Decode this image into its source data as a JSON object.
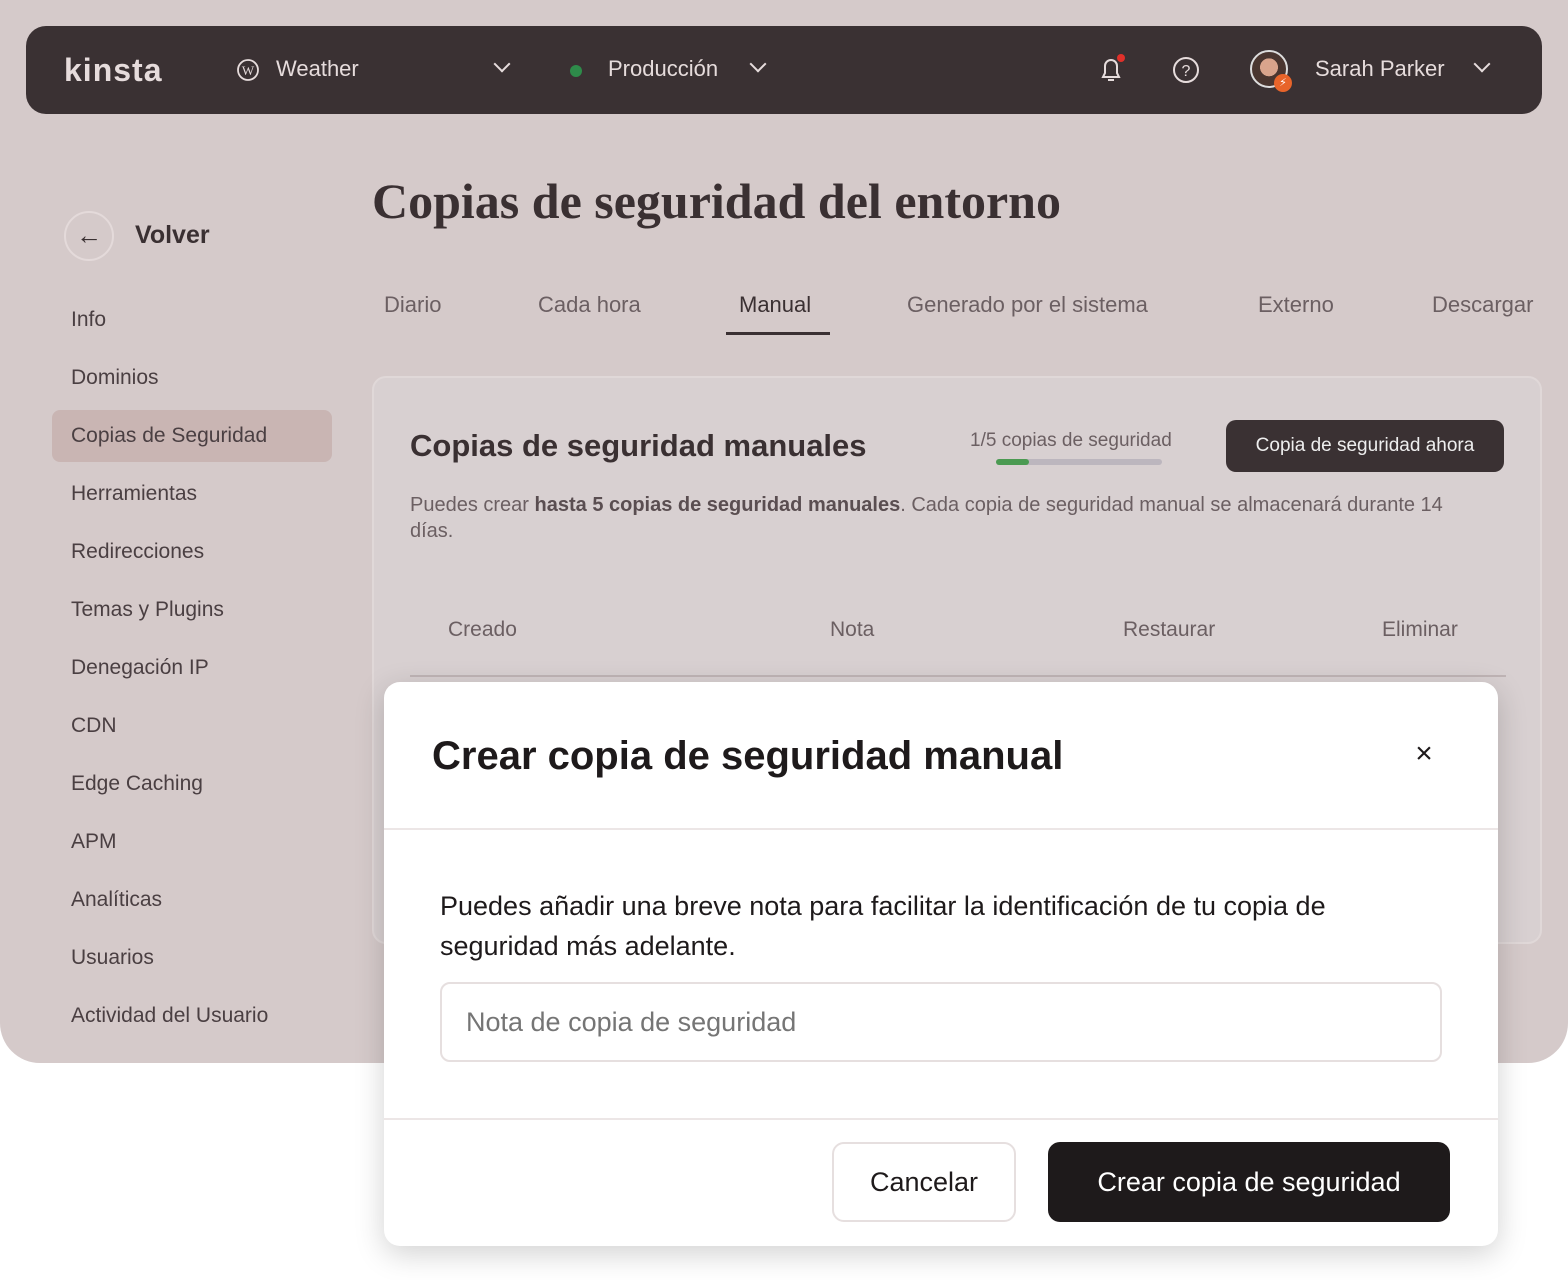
{
  "topbar": {
    "logo": "kinsta",
    "site": "Weather",
    "environment": "Producción",
    "env_color": "#2e8b4a",
    "user": "Sarah Parker"
  },
  "sidebar": {
    "back": "Volver",
    "items": [
      {
        "label": "Info"
      },
      {
        "label": "Dominios"
      },
      {
        "label": "Copias de Seguridad",
        "active": true
      },
      {
        "label": "Herramientas"
      },
      {
        "label": "Redirecciones"
      },
      {
        "label": "Temas y Plugins"
      },
      {
        "label": "Denegación IP"
      },
      {
        "label": "CDN"
      },
      {
        "label": "Edge Caching"
      },
      {
        "label": "APM"
      },
      {
        "label": "Analíticas"
      },
      {
        "label": "Usuarios"
      },
      {
        "label": "Actividad del Usuario"
      }
    ]
  },
  "main": {
    "title": "Copias de seguridad del entorno",
    "tabs": [
      "Diario",
      "Cada hora",
      "Manual",
      "Generado por el sistema",
      "Externo",
      "Descargar"
    ],
    "card": {
      "title": "Copias de seguridad manuales",
      "usage": "1/5 copias de seguridad",
      "usage_fraction": 0.2,
      "button": "Copia de seguridad ahora",
      "desc_pre": "Puedes crear ",
      "desc_bold": "hasta 5 copias de seguridad manuales",
      "desc_post": ". Cada copia de seguridad manual se almacenará durante 14 días.",
      "columns": [
        "Creado",
        "Nota",
        "Restaurar",
        "Eliminar"
      ]
    }
  },
  "modal": {
    "title": "Crear copia de seguridad manual",
    "body": "Puedes añadir una breve nota para facilitar la identificación de tu copia de seguridad más adelante.",
    "placeholder": "Nota de copia de seguridad",
    "cancel": "Cancelar",
    "confirm": "Crear copia de seguridad"
  }
}
